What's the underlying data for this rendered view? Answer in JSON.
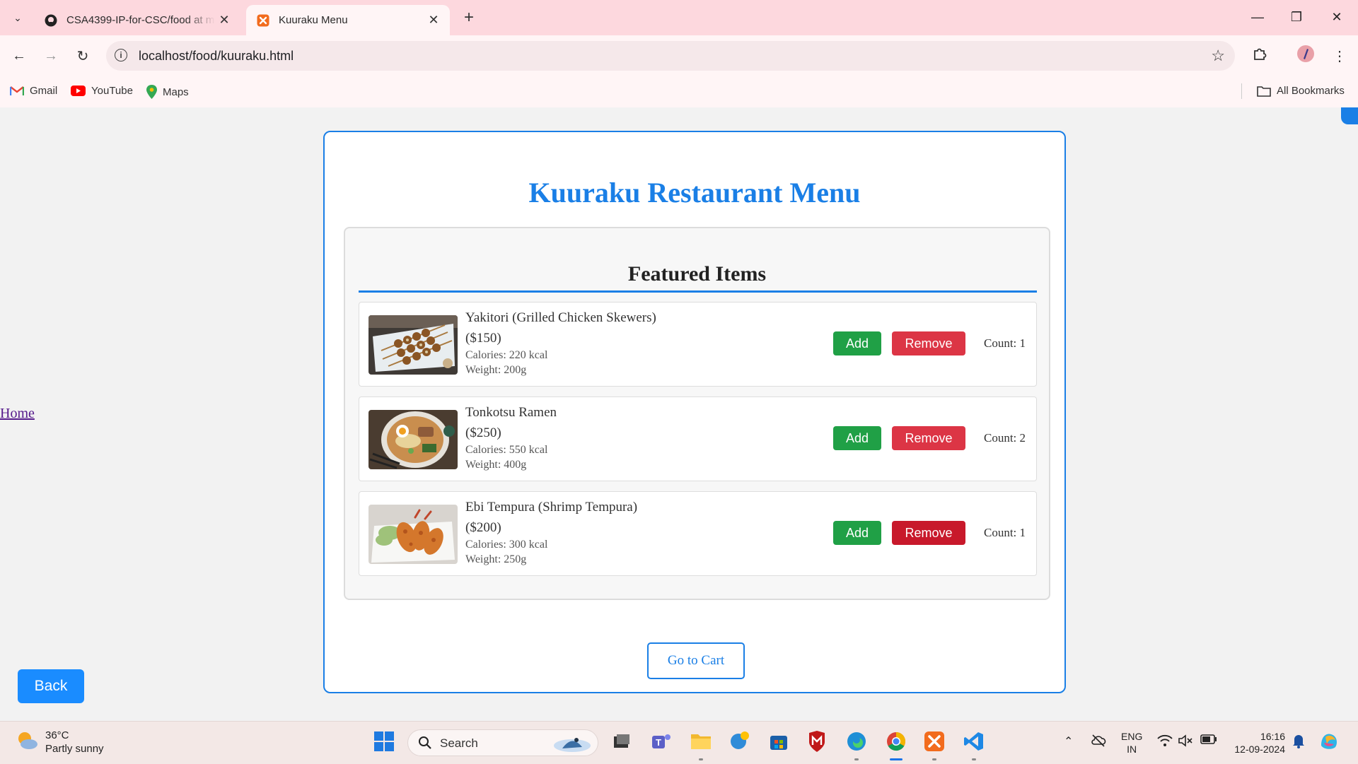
{
  "browser": {
    "tabs": [
      {
        "title": "CSA4399-IP-for-CSC/food at main",
        "active": false,
        "icon": "github-icon"
      },
      {
        "title": "Kuuraku Menu",
        "active": true,
        "icon": "xampp-icon"
      }
    ],
    "url": "localhost/food/kuuraku.html",
    "bookmarks": [
      {
        "label": "Gmail",
        "icon": "gmail-icon"
      },
      {
        "label": "YouTube",
        "icon": "youtube-icon"
      },
      {
        "label": "Maps",
        "icon": "maps-icon"
      }
    ],
    "all_bookmarks_label": "All Bookmarks"
  },
  "page": {
    "title": "Kuuraku Restaurant Menu",
    "home_link": "Home",
    "back_label": "Back",
    "featured_title": "Featured Items",
    "cart_label": "Go to Cart",
    "items": [
      {
        "name": "Yakitori (Grilled Chicken Skewers)",
        "price": "($150)",
        "calories": "Calories: 220 kcal",
        "weight": "Weight: 200g",
        "add_label": "Add",
        "remove_label": "Remove",
        "count": "Count: 1"
      },
      {
        "name": "Tonkotsu Ramen",
        "price": "($250)",
        "calories": "Calories: 550 kcal",
        "weight": "Weight: 400g",
        "add_label": "Add",
        "remove_label": "Remove",
        "count": "Count: 2"
      },
      {
        "name": "Ebi Tempura (Shrimp Tempura)",
        "price": "($200)",
        "calories": "Calories: 300 kcal",
        "weight": "Weight: 250g",
        "add_label": "Add",
        "remove_label": "Remove",
        "count": "Count: 1"
      }
    ]
  },
  "taskbar": {
    "weather_temp": "36°C",
    "weather_desc": "Partly sunny",
    "search_label": "Search",
    "lang_line1": "ENG",
    "lang_line2": "IN",
    "time": "16:16",
    "date": "12-09-2024"
  },
  "colors": {
    "accent": "#1a7fe6",
    "add": "#20a046",
    "remove": "#dc3545",
    "tabbar": "#fdd8de"
  }
}
